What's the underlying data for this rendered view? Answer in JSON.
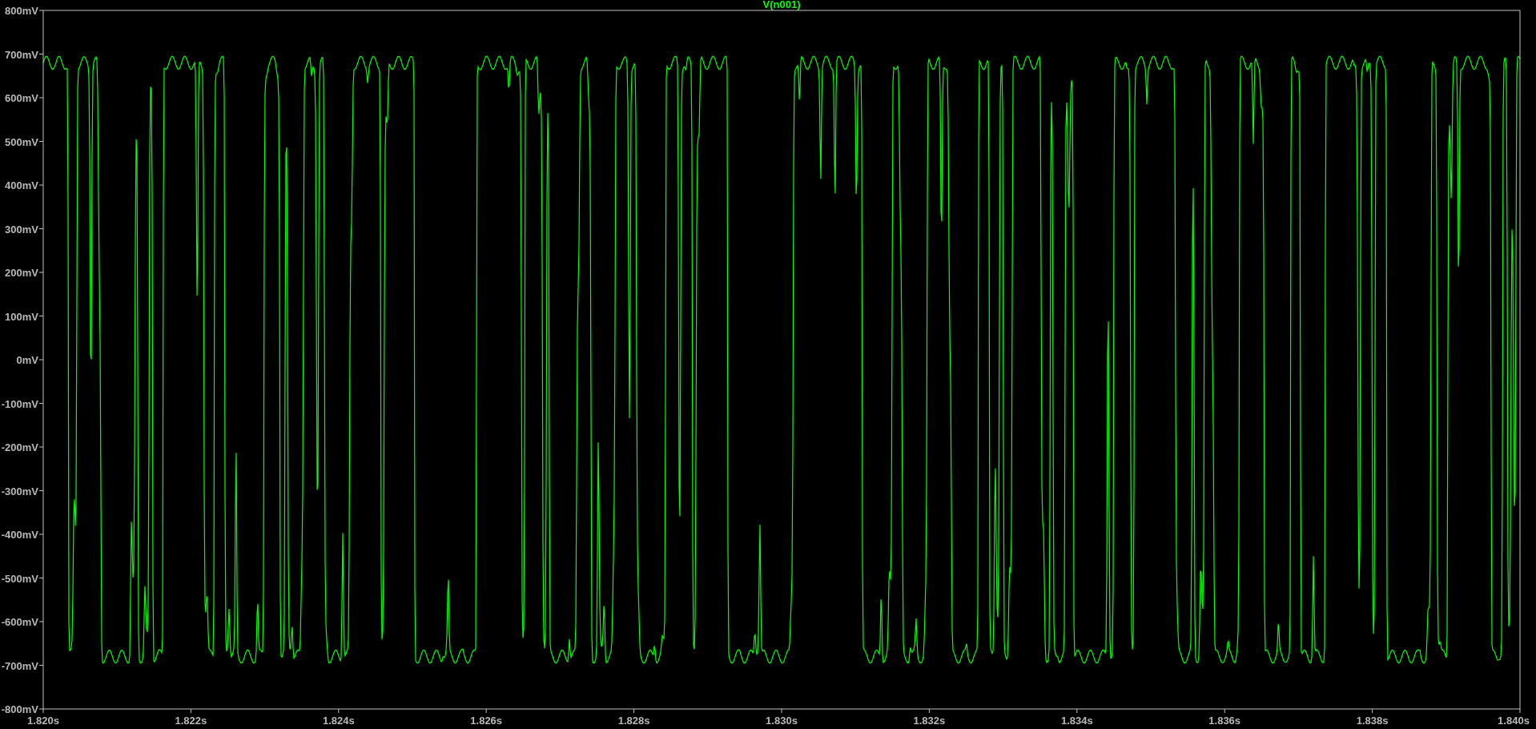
{
  "plot": {
    "title": "V(n001)",
    "y_axis_labels": [
      "800mV",
      "700mV",
      "600mV",
      "500mV",
      "400mV",
      "300mV",
      "200mV",
      "100mV",
      "0mV",
      "-100mV",
      "-200mV",
      "-300mV",
      "-400mV",
      "-500mV",
      "-600mV",
      "-700mV",
      "-800mV"
    ],
    "x_axis_labels": [
      "1.820s",
      "1.822s",
      "1.824s",
      "1.826s",
      "1.828s",
      "1.830s",
      "1.832s",
      "1.834s",
      "1.836s",
      "1.838s",
      "1.840s"
    ]
  }
}
